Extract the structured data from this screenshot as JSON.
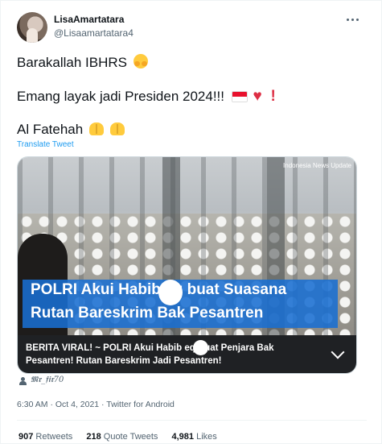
{
  "author": {
    "display_name": "LisaAmartatara",
    "handle": "@Lisaamartatara4",
    "avatar_icon": "profile-photo"
  },
  "tweet": {
    "line1": "Barakallah IBHRS",
    "line1_emoji": "hugging-face-emoji",
    "line2": "Emang layak jadi Presiden 2024!!!",
    "line2_emoji": [
      "indonesia-flag-emoji",
      "red-heart-emoji",
      "red-exclamation-emoji"
    ],
    "line3": "Al Fatehah",
    "line3_emoji": [
      "folded-hands-emoji",
      "folded-hands-emoji"
    ],
    "translate_label": "Translate Tweet"
  },
  "media": {
    "watermark": "Indonesia News Update",
    "headline_line1": "POLRI Akui Habib    eq buat Suasana",
    "headline_line2": "Rutan Bareskrim Bak Pesantren",
    "card_title": "BERITA VIRAL! ~ POLRI Akui Habib     eq Buat Penjara Bak Pesantren! Rutan Bareskrim Jadi Pesantren!",
    "headline_bg": "#1e6ed2"
  },
  "credit": {
    "name": "𝕸𝖗_𝖋𝖎𝖗70"
  },
  "meta": {
    "timestamp": "6:30 AM · Oct 4, 2021 · Twitter for Android"
  },
  "stats": {
    "retweets_count": "907",
    "retweets_label": "Retweets",
    "quotes_count": "218",
    "quotes_label": "Quote Tweets",
    "likes_count": "4,981",
    "likes_label": "Likes"
  },
  "colors": {
    "link": "#1d9bf0",
    "secondary_text": "#536471",
    "primary_text": "#0f1419"
  }
}
